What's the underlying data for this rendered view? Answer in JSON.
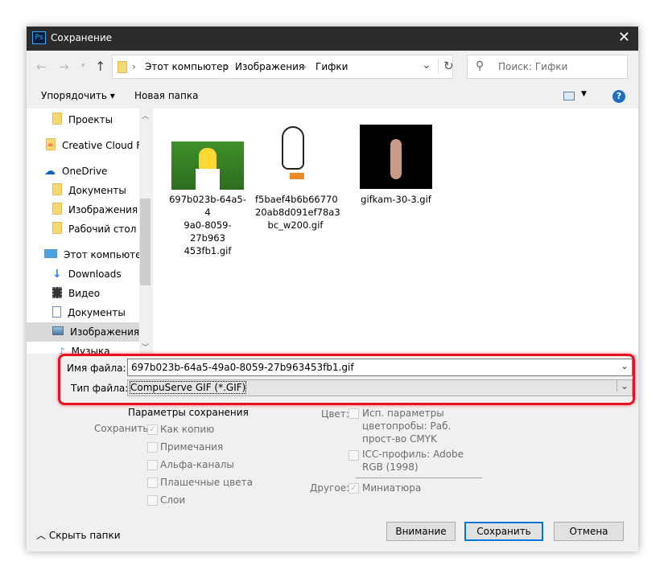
{
  "window": {
    "title": "Сохранение",
    "app_icon": "Ps"
  },
  "nav": {
    "breadcrumb": [
      "Этот компьютер",
      "Изображения",
      "Гифки"
    ],
    "search_placeholder": "Поиск: Гифки"
  },
  "toolbar": {
    "organize": "Упорядочить",
    "new_folder": "Новая папка",
    "help": "?"
  },
  "sidebar": {
    "items": [
      {
        "label": "Проекты",
        "icon": "folder-icon"
      },
      {
        "label": "Creative Cloud Fil",
        "icon": "creative-cloud-folder-icon"
      },
      {
        "label": "OneDrive",
        "icon": "onedrive-cloud-icon"
      },
      {
        "label": "Документы",
        "icon": "folder-icon"
      },
      {
        "label": "Изображения",
        "icon": "folder-icon"
      },
      {
        "label": "Рабочий стол",
        "icon": "folder-icon"
      },
      {
        "label": "Этот компьютер",
        "icon": "computer-icon"
      },
      {
        "label": "Downloads",
        "icon": "download-icon"
      },
      {
        "label": "Видео",
        "icon": "video-icon"
      },
      {
        "label": "Документы",
        "icon": "document-icon"
      },
      {
        "label": "Изображения",
        "icon": "pictures-icon"
      },
      {
        "label": "Музыка",
        "icon": "music-icon"
      }
    ]
  },
  "files": [
    {
      "name": "697b023b-64a5-49a0-8059-27b963453fb1.gif",
      "lines": [
        "697b023b-64a5-4",
        "9a0-8059-27b963",
        "453fb1.gif"
      ]
    },
    {
      "name": "f5baef4b6b6677020ab8d091ef78a3bc_w200.gif",
      "lines": [
        "f5baef4b6b66770",
        "20ab8d091ef78a3",
        "bc_w200.gif"
      ]
    },
    {
      "name": "gifkam-30-3.gif",
      "lines": [
        "gifkam-30-3.gif"
      ]
    }
  ],
  "form": {
    "filename_label": "Имя файла:",
    "filename_value": "697b023b-64a5-49a0-8059-27b963453fb1.gif",
    "filetype_label": "Тип файла:",
    "filetype_value": "CompuServe GIF (*.GIF)"
  },
  "options": {
    "heading": "Параметры сохранения",
    "save_label": "Сохранить:",
    "save_items": [
      {
        "label": "Как копию",
        "checked": true
      },
      {
        "label": "Примечания",
        "checked": false
      },
      {
        "label": "Альфа-каналы",
        "checked": false
      },
      {
        "label": "Плашечные цвета",
        "checked": false
      },
      {
        "label": "Слои",
        "checked": false
      }
    ],
    "color_label": "Цвет:",
    "proof": [
      "Исп. параметры",
      "цветопробы:  Раб.",
      "прост-во CMYK"
    ],
    "icc": [
      "ICC-профиль:  Adobe",
      "RGB (1998)"
    ],
    "other_label": "Другое:",
    "thumbnail": "Миниатюра"
  },
  "footer": {
    "hide_folders": "Скрыть папки",
    "warning": "Внимание",
    "save": "Сохранить",
    "cancel": "Отмена"
  },
  "colors": {
    "highlight": "#e81123",
    "accent": "#0078d7"
  }
}
